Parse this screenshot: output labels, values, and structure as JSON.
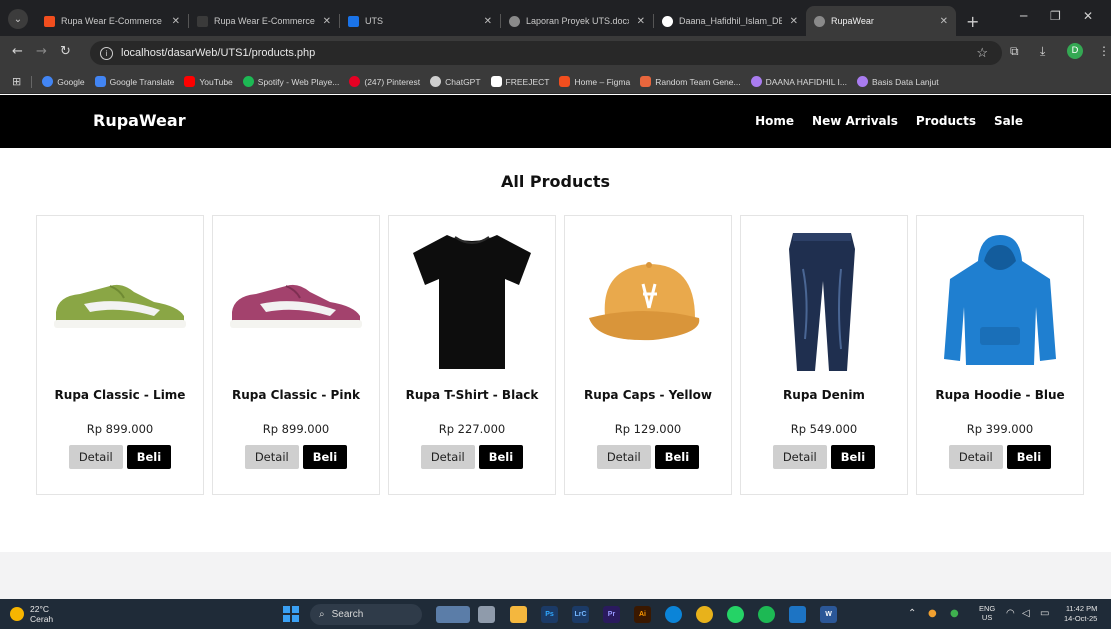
{
  "browser": {
    "tabs": [
      {
        "title": "Rupa Wear E-Commerce -",
        "icon": "figma-icon",
        "color": "#f24e1e"
      },
      {
        "title": "Rupa Wear E-Commerce",
        "icon": "play-icon",
        "color": "#3a3a3a"
      },
      {
        "title": "UTS",
        "icon": "presentation-icon",
        "color": "#1a73e8"
      },
      {
        "title": "Laporan Proyek UTS.docx",
        "icon": "globe-icon",
        "color": "#8a8a8a"
      },
      {
        "title": "Daana_Hafidhil_Islam_DES",
        "icon": "github-icon",
        "color": "#ffffff"
      },
      {
        "title": "RupaWear",
        "icon": "globe-icon",
        "color": "#8a8a8a"
      }
    ],
    "url": "localhost/dasarWeb/UTS1/products.php",
    "profile_initial": "D",
    "bookmarks": [
      {
        "label": "Google",
        "color": "#4285f4"
      },
      {
        "label": "Google Translate",
        "color": "#4285f4"
      },
      {
        "label": "YouTube",
        "color": "#ff0000"
      },
      {
        "label": "Spotify - Web Playe...",
        "color": "#1db954"
      },
      {
        "label": "(247) Pinterest",
        "color": "#e60023"
      },
      {
        "label": "ChatGPT",
        "color": "#cfcfcf"
      },
      {
        "label": "FREEJECT",
        "color": "#ffffff"
      },
      {
        "label": "Home – Figma",
        "color": "#f24e1e"
      },
      {
        "label": "Random Team Gene...",
        "color": "#e8663d"
      },
      {
        "label": "DAANA HAFIDHIL I...",
        "color": "#a97cf0"
      },
      {
        "label": "Basis Data Lanjut",
        "color": "#a97cf0"
      }
    ]
  },
  "site": {
    "brand": "RupaWear",
    "nav": [
      "Home",
      "New Arrivals",
      "Products",
      "Sale"
    ],
    "heading": "All Products",
    "products": [
      {
        "name": "Rupa Classic - Lime",
        "price": "Rp 899.000",
        "detail": "Detail",
        "buy": "Beli",
        "image": "sneaker-lime-icon",
        "color": "#8aa645"
      },
      {
        "name": "Rupa Classic - Pink",
        "price": "Rp 899.000",
        "detail": "Detail",
        "buy": "Beli",
        "image": "sneaker-pink-icon",
        "color": "#a3426d"
      },
      {
        "name": "Rupa T-Shirt - Black",
        "price": "Rp 227.000",
        "detail": "Detail",
        "buy": "Beli",
        "image": "tshirt-black-icon",
        "color": "#0d0d0d"
      },
      {
        "name": "Rupa Caps - Yellow",
        "price": "Rp 129.000",
        "detail": "Detail",
        "buy": "Beli",
        "image": "cap-yellow-icon",
        "color": "#e9a94c"
      },
      {
        "name": "Rupa Denim",
        "price": "Rp 549.000",
        "detail": "Detail",
        "buy": "Beli",
        "image": "denim-jeans-icon",
        "color": "#1f2f4f"
      },
      {
        "name": "Rupa Hoodie - Blue",
        "price": "Rp 399.000",
        "detail": "Detail",
        "buy": "Beli",
        "image": "hoodie-blue-icon",
        "color": "#1f7fd0"
      }
    ]
  },
  "taskbar": {
    "temperature": "22°C",
    "weather": "Cerah",
    "search": "Search",
    "lang_top": "ENG",
    "lang_bottom": "US",
    "time": "11:42 PM",
    "date": "14-Oct-25"
  }
}
